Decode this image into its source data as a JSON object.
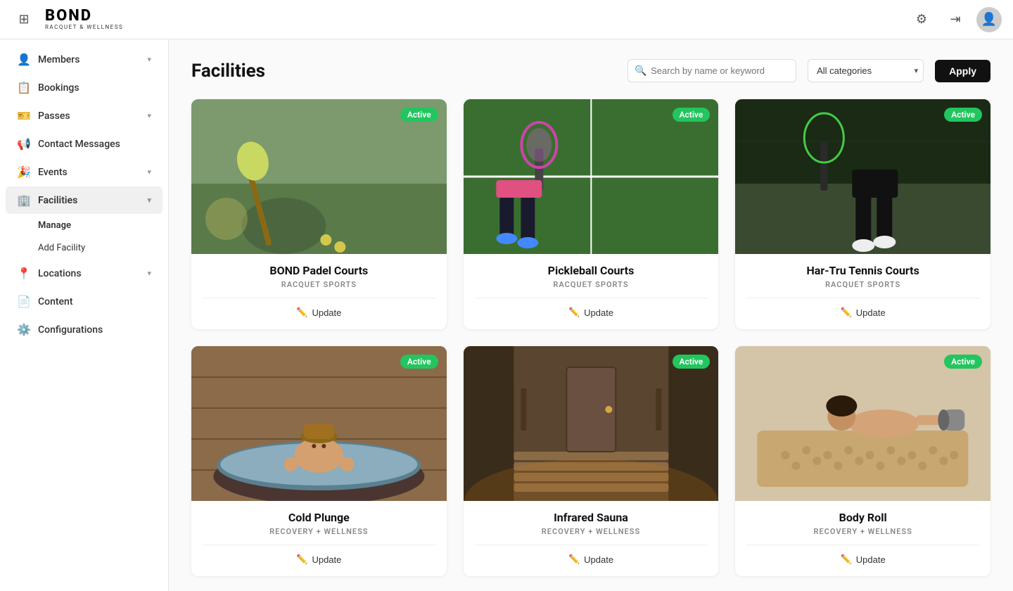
{
  "topbar": {
    "logo_text": "BOND",
    "logo_sub": "RACQUET & WELLNESS",
    "grid_icon": "⊞"
  },
  "sidebar": {
    "items": [
      {
        "id": "members",
        "label": "Members",
        "icon": "👤",
        "has_chevron": true,
        "active": false
      },
      {
        "id": "bookings",
        "label": "Bookings",
        "icon": "📋",
        "has_chevron": false,
        "active": false
      },
      {
        "id": "passes",
        "label": "Passes",
        "icon": "🎫",
        "has_chevron": true,
        "active": false
      },
      {
        "id": "contact-messages",
        "label": "Contact Messages",
        "icon": "📢",
        "has_chevron": false,
        "active": false
      },
      {
        "id": "events",
        "label": "Events",
        "icon": "🎉",
        "has_chevron": true,
        "active": false
      },
      {
        "id": "facilities",
        "label": "Facilities",
        "icon": "🏢",
        "has_chevron": true,
        "active": true
      },
      {
        "id": "locations",
        "label": "Locations",
        "icon": "📍",
        "has_chevron": true,
        "active": false
      },
      {
        "id": "content",
        "label": "Content",
        "icon": "📄",
        "has_chevron": false,
        "active": false
      },
      {
        "id": "configurations",
        "label": "Configurations",
        "icon": "⚙️",
        "has_chevron": false,
        "active": false
      }
    ],
    "sub_items": [
      {
        "id": "manage",
        "label": "Manage",
        "parent": "facilities"
      },
      {
        "id": "add-facility",
        "label": "Add Facility",
        "parent": "facilities"
      }
    ]
  },
  "page": {
    "title": "Facilities",
    "search_placeholder": "Search by name or keyword",
    "category_default": "All categories",
    "apply_label": "Apply"
  },
  "facilities": [
    {
      "id": "bond-padel",
      "name": "BOND Padel Courts",
      "category": "RACQUET SPORTS",
      "status": "Active",
      "img_class": "img-padel",
      "update_label": "Update"
    },
    {
      "id": "pickleball",
      "name": "Pickleball Courts",
      "category": "RACQUET SPORTS",
      "status": "Active",
      "img_class": "img-pickleball",
      "update_label": "Update"
    },
    {
      "id": "tennis",
      "name": "Har-Tru Tennis Courts",
      "category": "RACQUET SPORTS",
      "status": "Active",
      "img_class": "img-tennis",
      "update_label": "Update"
    },
    {
      "id": "cold-plunge",
      "name": "Cold Plunge",
      "category": "RECOVERY + WELLNESS",
      "status": "Active",
      "img_class": "img-coldplunge",
      "update_label": "Update"
    },
    {
      "id": "infrared-sauna",
      "name": "Infrared Sauna",
      "category": "RECOVERY + WELLNESS",
      "status": "Active",
      "img_class": "img-sauna",
      "update_label": "Update"
    },
    {
      "id": "body-roll",
      "name": "Body Roll",
      "category": "RECOVERY + WELLNESS",
      "status": "Active",
      "img_class": "img-bodyroll",
      "update_label": "Update"
    }
  ]
}
